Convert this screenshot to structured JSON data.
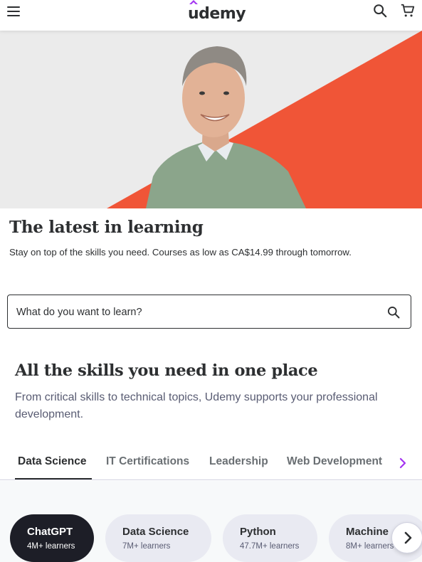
{
  "header": {
    "logo_text": "udemy",
    "menu_icon": "hamburger-menu-icon",
    "search_icon": "search-icon",
    "cart_icon": "cart-icon",
    "brand_color": "#a435f0"
  },
  "hero": {
    "accent_color": "#f05537",
    "image": "smiling-man-green-sweater"
  },
  "promo": {
    "headline": "The latest in learning",
    "subline": "Stay on top of the skills you need. Courses as low as CA$14.99 through tomorrow."
  },
  "search": {
    "placeholder": "What do you want to learn?"
  },
  "skills": {
    "title": "All the skills you need in one place",
    "description": "From critical skills to technical topics, Udemy supports your professional development.",
    "tabs": [
      {
        "label": "Data Science",
        "active": true
      },
      {
        "label": "IT Certifications",
        "active": false
      },
      {
        "label": "Leadership",
        "active": false
      },
      {
        "label": "Web Development",
        "active": false
      }
    ],
    "topics": [
      {
        "title": "ChatGPT",
        "learners": "4M+ learners",
        "active": true
      },
      {
        "title": "Data Science",
        "learners": "7M+ learners",
        "active": false
      },
      {
        "title": "Python",
        "learners": "47.7M+ learners",
        "active": false
      },
      {
        "title": "Machine",
        "learners": "8M+ learners",
        "active": false
      }
    ]
  }
}
